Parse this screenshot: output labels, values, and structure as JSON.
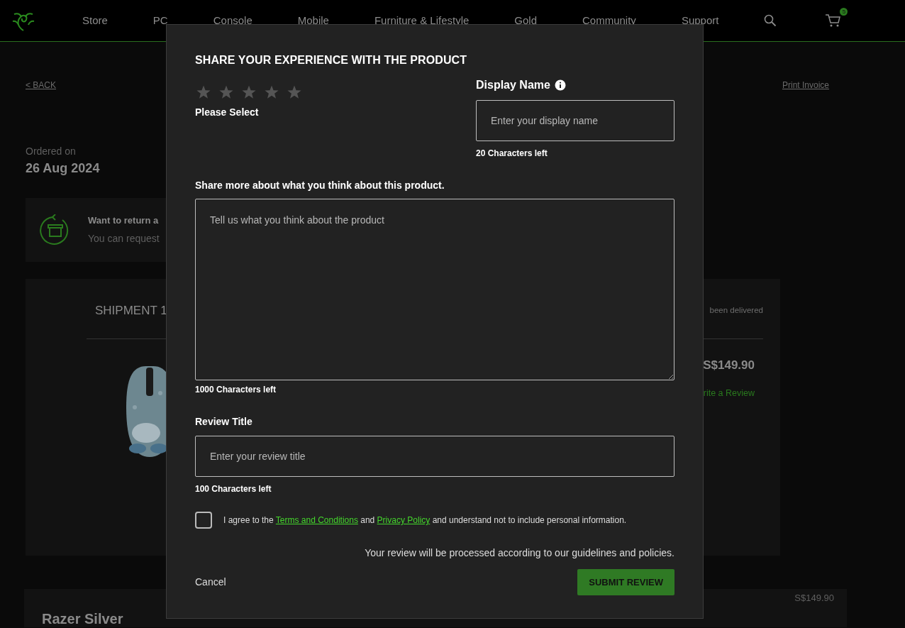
{
  "navbar": {
    "items": [
      "Store",
      "PC",
      "Console",
      "Mobile",
      "Furniture & Lifestyle",
      "Gold",
      "Community",
      "Support"
    ],
    "cart_count": "5"
  },
  "page": {
    "back": "< BACK",
    "print_invoice": "Print Invoice",
    "ordered_label": "Ordered on",
    "ordered_date": "26 Aug 2024",
    "return_notice": {
      "title": "Want to return a",
      "text": "You can request"
    },
    "shipment": {
      "title": "SHIPMENT 1",
      "status": "been delivered",
      "price": "S$149.90",
      "review_link": "rite a Review"
    },
    "silver": {
      "title": "Razer Silver",
      "price": "S$149.90"
    }
  },
  "modal": {
    "title": "SHARE YOUR EXPERIENCE WITH THE PRODUCT",
    "rating": {
      "stars": 0,
      "hint": "Please Select"
    },
    "display_name": {
      "label": "Display Name",
      "placeholder": "Enter your display name",
      "counter": "20 Characters left"
    },
    "review": {
      "label": "Share more about what you think about this product.",
      "placeholder": "Tell us what you think about the product",
      "counter": "1000 Characters left"
    },
    "review_title": {
      "label": "Review Title",
      "placeholder": "Enter your review title",
      "counter": "100 Characters left"
    },
    "agree": {
      "checked": false,
      "parts": [
        {
          "kind": "text",
          "text": "I agree to the "
        },
        {
          "kind": "link",
          "text": "Terms and Conditions"
        },
        {
          "kind": "text",
          "text": " and "
        },
        {
          "kind": "link",
          "text": "Privacy Policy"
        },
        {
          "kind": "text",
          "text": " and understand not to include personal information."
        }
      ]
    },
    "notice": "Your review will be processed according to our guidelines and policies.",
    "cancel": "Cancel",
    "submit": "SUBMIT REVIEW"
  }
}
